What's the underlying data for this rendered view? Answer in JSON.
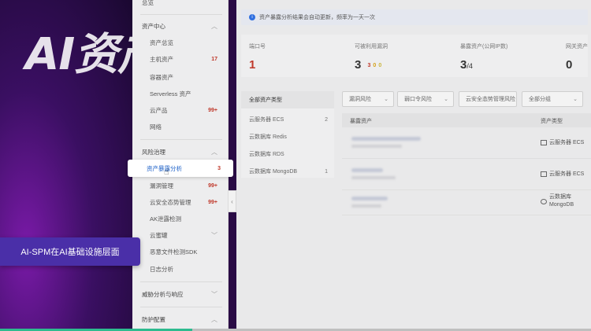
{
  "hero": {
    "text": "AI资产"
  },
  "caption": {
    "text": "AI-SPM在AI基础设施层面"
  },
  "sidebar": {
    "top_partial": "总览",
    "groups": [
      {
        "label": "资产中心",
        "items": [
          {
            "label": "资产总览",
            "count": ""
          },
          {
            "label": "主机资产",
            "count": "17"
          },
          {
            "label": "容器资产",
            "count": ""
          },
          {
            "label": "Serverless 资产",
            "count": ""
          },
          {
            "label": "云产品",
            "count": "99+"
          },
          {
            "label": "网络",
            "count": ""
          }
        ]
      },
      {
        "label": "风险治理",
        "items": [
          {
            "label": "资产暴露分析",
            "count": "3",
            "active": true
          },
          {
            "label": "漏洞管理",
            "count": "99+"
          },
          {
            "label": "云安全态势管理",
            "count": "99+"
          },
          {
            "label": "AK泄露检测",
            "count": ""
          },
          {
            "label": "云蜜罐",
            "count": ""
          },
          {
            "label": "恶意文件检测SDK",
            "count": ""
          },
          {
            "label": "日志分析",
            "count": ""
          }
        ]
      },
      {
        "label": "威胁分析与响应",
        "items": []
      },
      {
        "label": "防护配置",
        "items": []
      }
    ]
  },
  "notice": {
    "text": "资产暴露分析结果会自动更新，频率为一天一次"
  },
  "stats": [
    {
      "label": "端口号",
      "value": "1",
      "red": true
    },
    {
      "label": "可被利用漏洞",
      "value": "3",
      "badges": [
        "3",
        "0",
        "0"
      ]
    },
    {
      "label": "暴露资产(公网IP数)",
      "value": "3",
      "suffix": "/4"
    },
    {
      "label": "网关资产",
      "value": "0"
    }
  ],
  "asset_types": [
    {
      "label": "全部资产类型",
      "count": ""
    },
    {
      "label": "云服务器 ECS",
      "count": "2"
    },
    {
      "label": "云数据库 Redis",
      "count": ""
    },
    {
      "label": "云数据库 RDS",
      "count": ""
    },
    {
      "label": "云数据库 MongoDB",
      "count": "1"
    }
  ],
  "filters": [
    {
      "label": "漏洞风险"
    },
    {
      "label": "弱口令风险"
    },
    {
      "label": "云安全态势管理风险"
    },
    {
      "label": "全部分组"
    }
  ],
  "table": {
    "col_asset": "暴露资产",
    "col_type": "资产类型",
    "rows": [
      {
        "type": "云服务器 ECS"
      },
      {
        "type": "云服务器 ECS"
      },
      {
        "type_line1": "云数据库",
        "type_line2": "MongoDB"
      }
    ]
  },
  "progress": {
    "fraction": 0.325
  }
}
